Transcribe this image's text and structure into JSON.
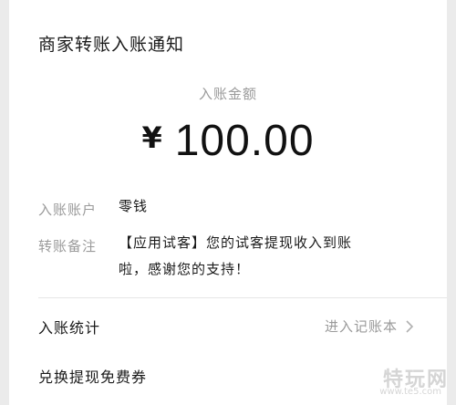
{
  "header": {
    "title": "商家转账入账通知"
  },
  "amount": {
    "label": "入账金额",
    "currency": "¥",
    "value": "100.00"
  },
  "details": {
    "account_label": "入账账户",
    "account_value": "零钱",
    "note_label": "转账备注",
    "note_line1": "【应用试客】您的试客提现收入到账",
    "note_line2": "啦，感谢您的支持！"
  },
  "stats": {
    "label": "入账统计",
    "link_text": "进入记账本",
    "link_icon": "chevron-right-icon"
  },
  "coupon": {
    "label": "兑换提现免费券"
  },
  "watermark": {
    "text": "特玩网",
    "url": "www.te5.com"
  },
  "colors": {
    "background": "#ebebeb",
    "card": "#ffffff",
    "primary_text": "#1a1a1a",
    "secondary_text": "#9a9a9a"
  }
}
